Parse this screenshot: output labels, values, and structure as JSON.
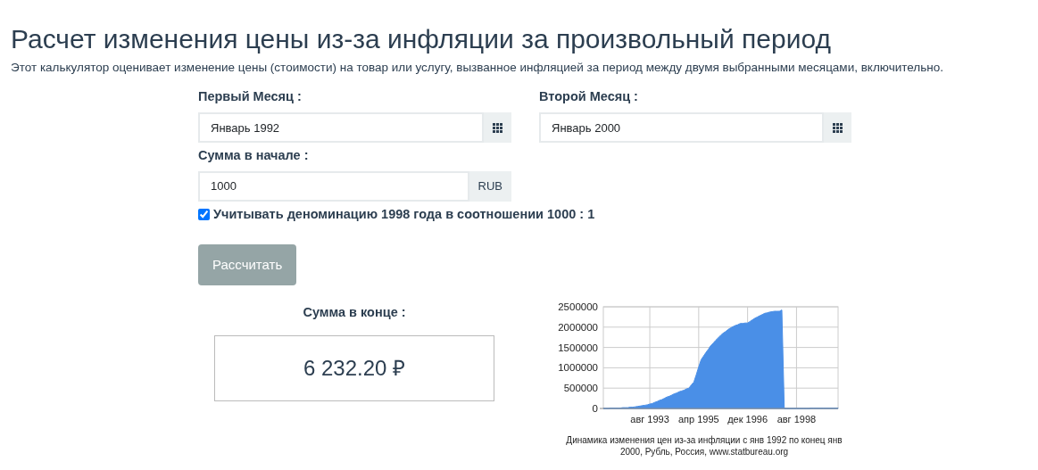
{
  "title": "Расчет изменения цены из-за инфляции за произвольный период",
  "description": "Этот калькулятор оценивает изменение цены (стоимости) на товар или услугу, вызванное инфляцией за период между двумя выбранными месяцами, включительно.",
  "first_month": {
    "label": "Первый Месяц :",
    "value": "Январь 1992"
  },
  "second_month": {
    "label": "Второй Месяц :",
    "value": "Январь 2000"
  },
  "start_amount": {
    "label": "Сумма в начале :",
    "value": "1000",
    "currency": "RUB"
  },
  "denomination": {
    "label": "Учитывать деноминацию 1998 года в соотношении 1000 : 1",
    "checked": true
  },
  "calculate_button": "Рассчитать",
  "result": {
    "label": "Сумма в конце :",
    "value": "6 232.20 ₽"
  },
  "chart": {
    "caption": "Динамика изменения цен из-за инфляции с янв 1992 по конец янв 2000, Рубль, Россия, www.statbureau.org",
    "chart_data": {
      "type": "area",
      "categories": [
        null,
        null,
        null,
        null,
        null,
        null,
        null,
        null,
        null,
        null,
        null,
        null,
        null,
        null,
        null,
        null,
        null,
        null,
        null,
        "авг 1993",
        null,
        null,
        null,
        null,
        null,
        null,
        null,
        null,
        null,
        null,
        null,
        null,
        null,
        null,
        null,
        null,
        null,
        null,
        null,
        "апр 1995",
        null,
        null,
        null,
        null,
        null,
        null,
        null,
        null,
        null,
        null,
        null,
        null,
        null,
        null,
        null,
        null,
        null,
        null,
        null,
        "дек 1996",
        null,
        null,
        null,
        null,
        null,
        null,
        null,
        null,
        null,
        null,
        null,
        null,
        null,
        null,
        null,
        null,
        null,
        null,
        null,
        "авг 1998",
        null,
        null,
        null,
        null,
        null,
        null,
        null,
        null,
        null,
        null,
        null,
        null,
        null,
        null,
        null,
        null,
        null
      ],
      "series": [
        {
          "color": "#4a8fe7",
          "values": [
            0,
            0,
            0,
            10000,
            10000,
            10000,
            10000,
            10000,
            20000,
            20000,
            20000,
            30000,
            30000,
            40000,
            50000,
            60000,
            70000,
            80000,
            90000,
            110000,
            120000,
            150000,
            170000,
            200000,
            220000,
            250000,
            280000,
            300000,
            330000,
            360000,
            380000,
            410000,
            430000,
            450000,
            480000,
            500000,
            580000,
            650000,
            830000,
            1020000,
            1200000,
            1290000,
            1380000,
            1460000,
            1550000,
            1610000,
            1680000,
            1740000,
            1800000,
            1850000,
            1890000,
            1940000,
            1980000,
            2010000,
            2040000,
            2060000,
            2090000,
            2090000,
            2100000,
            2100000,
            2140000,
            2180000,
            2220000,
            2250000,
            2280000,
            2310000,
            2340000,
            2350000,
            2370000,
            2380000,
            2390000,
            2390000,
            2390000,
            2420000,
            0,
            0,
            0,
            0,
            0,
            0,
            0,
            0,
            0,
            0,
            0,
            10000,
            10000,
            10000,
            10000,
            10000,
            10000,
            10000,
            10000,
            10000,
            10000,
            10000,
            10000
          ]
        }
      ],
      "grid": true,
      "ylim": [
        0,
        2500000
      ],
      "yticks": [
        0,
        500000,
        1000000,
        1500000,
        2000000,
        2500000
      ]
    }
  }
}
